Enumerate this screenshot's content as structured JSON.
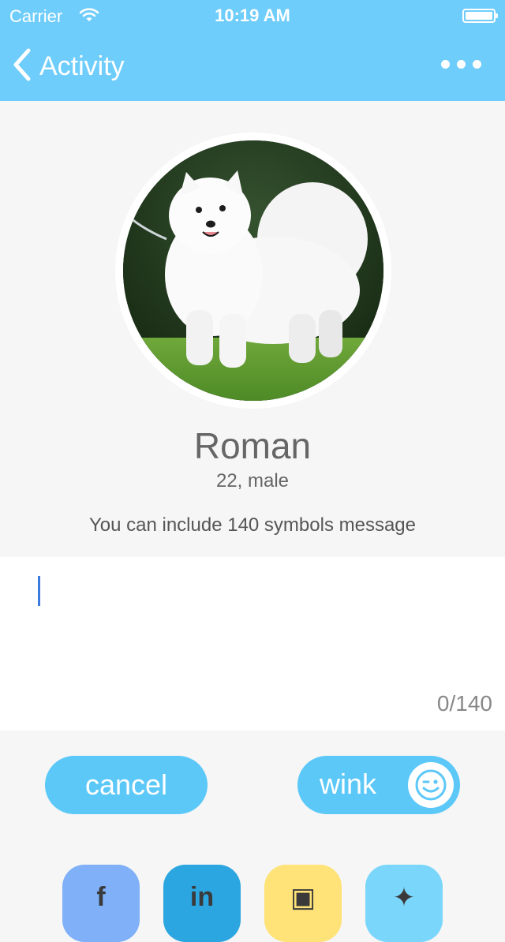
{
  "status_bar": {
    "carrier": "Carrier",
    "time": "10:19 AM"
  },
  "nav": {
    "back_label": "Activity"
  },
  "profile": {
    "name": "Roman",
    "details": "22, male",
    "hint": "You can include 140 symbols message"
  },
  "message": {
    "value": "",
    "counter": "0/140"
  },
  "buttons": {
    "cancel": "cancel",
    "wink": "wink"
  },
  "colors": {
    "header": "#6fcdfb",
    "button": "#5cc8f8",
    "background": "#f6f6f6",
    "social_facebook": "#7fb0f8",
    "social_linkedin": "#2ca6e0",
    "social_instagram": "#ffe278",
    "social_twitter": "#7ad6fb"
  },
  "icons": {
    "nav": [
      "chevron-left-icon",
      "more-dots-icon"
    ],
    "status": [
      "wifi-icon",
      "battery-icon"
    ],
    "wink": "wink-face-icon",
    "social": [
      "facebook-icon",
      "linkedin-icon",
      "instagram-icon",
      "twitter-icon"
    ]
  }
}
